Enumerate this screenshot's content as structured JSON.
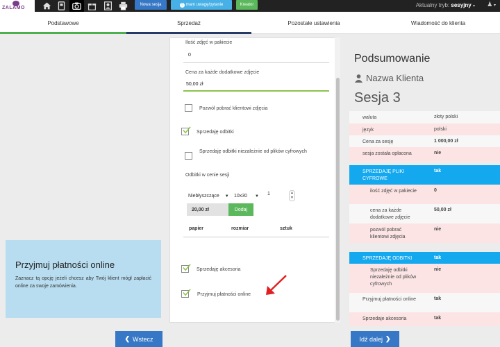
{
  "topbar": {
    "logo_text": "ZALAMO",
    "nav_icons": [
      "home-icon",
      "address-book-icon",
      "camera-icon",
      "gift-icon",
      "portrait-icon",
      "print-icon"
    ],
    "new_session_label": "Nowa sesja",
    "feedback_label": "mam uwagę/pytanie",
    "creator_label": "Kreator",
    "mode_label": "Aktualny tryb:",
    "mode_value": "sesyjny",
    "colors": {
      "new_session": "#3778c6",
      "feedback": "#47b0e6",
      "creator": "#5cb85c"
    }
  },
  "tabs": [
    {
      "label": "Podstawowe"
    },
    {
      "label": "Sprzedaż"
    },
    {
      "label": "Pozostałe ustawienia"
    },
    {
      "label": "Wiadomość do klienta"
    }
  ],
  "info": {
    "title": "Przyjmuj płatności online",
    "text": "Zaznacz tą opcję jeżeli chcesz aby Twój klient mógł zapłacić online za swoje zamówienia."
  },
  "form": {
    "photos_in_package_label": "Ilość zdjęć w pakiecie",
    "photos_in_package_value": "0",
    "extra_photo_price_label": "Cena za każde dodatkowe zdjęcie",
    "extra_photo_price_value": "50,00 zł",
    "allow_download_label": "Pozwól pobrać klientowi zdjęcia",
    "allow_download_checked": false,
    "sell_prints_label": "Sprzedaję odbitki",
    "sell_prints_checked": true,
    "sell_prints_independent_label": "Sprzedaję odbitki niezależnie od plików cyfrowych",
    "sell_prints_independent_checked": false,
    "prints_in_price_label": "Odbitki w cenie sesji",
    "paper_select": "Niebłyszczące",
    "size_select": "10x30",
    "quantity": "1",
    "price": "20,00 zł",
    "add_label": "Dodaj",
    "table_headers": [
      "papier",
      "rozmiar",
      "sztuk"
    ],
    "sell_accessories_label": "Sprzedaję akcesoria",
    "sell_accessories_checked": true,
    "accept_online_label": "Przyjmuj płatności online",
    "accept_online_checked": true
  },
  "summary": {
    "title": "Podsumowanie",
    "client": "Nazwa Klienta",
    "session": "Sesja 3",
    "rows": [
      {
        "key": "waluta",
        "value": "złoty polski"
      },
      {
        "key": "język",
        "value": "polski"
      },
      {
        "key": "Cena za sesję",
        "value": "1 000,00 zł"
      },
      {
        "key": "sesja została opłacona",
        "value": "nie"
      }
    ],
    "digital": {
      "key": "SPRZEDAJĘ PLIKI CYFROWE",
      "value": "tak"
    },
    "digital_rows": [
      {
        "key": "ilość zdjęć w pakiecie",
        "value": "0"
      },
      {
        "key": "cena za każde dodatkowe zdjęcie",
        "value": "50,00 zł"
      },
      {
        "key": "pozwól pobrać klientowi zdjęcia",
        "value": "nie"
      }
    ],
    "prints": {
      "key": "SPRZEDAJĘ ODBITKI",
      "value": "tak"
    },
    "prints_rows": [
      {
        "key": "Sprzedaję odbitki niezależnie od plików cyfrowych",
        "value": "nie"
      }
    ],
    "tail_rows": [
      {
        "key": "Przyjmuj płatności online",
        "value": "tak"
      },
      {
        "key": "Sprzedaje akcesoria",
        "value": "tak"
      }
    ]
  },
  "footer": {
    "back_label": "Wstecz",
    "next_label": "Idź dalej"
  }
}
